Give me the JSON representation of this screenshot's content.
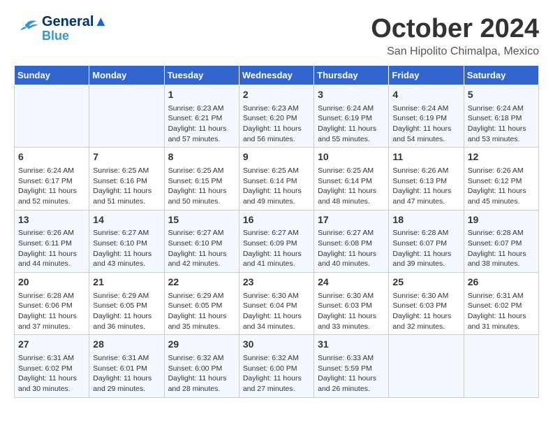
{
  "header": {
    "logo": {
      "line1": "General",
      "line2": "Blue"
    },
    "title": "October 2024",
    "subtitle": "San Hipolito Chimalpa, Mexico"
  },
  "days_of_week": [
    "Sunday",
    "Monday",
    "Tuesday",
    "Wednesday",
    "Thursday",
    "Friday",
    "Saturday"
  ],
  "weeks": [
    [
      {
        "day": null
      },
      {
        "day": null
      },
      {
        "day": "1",
        "sunrise": "6:23 AM",
        "sunset": "6:21 PM",
        "daylight": "11 hours and 57 minutes."
      },
      {
        "day": "2",
        "sunrise": "6:23 AM",
        "sunset": "6:20 PM",
        "daylight": "11 hours and 56 minutes."
      },
      {
        "day": "3",
        "sunrise": "6:24 AM",
        "sunset": "6:19 PM",
        "daylight": "11 hours and 55 minutes."
      },
      {
        "day": "4",
        "sunrise": "6:24 AM",
        "sunset": "6:19 PM",
        "daylight": "11 hours and 54 minutes."
      },
      {
        "day": "5",
        "sunrise": "6:24 AM",
        "sunset": "6:18 PM",
        "daylight": "11 hours and 53 minutes."
      }
    ],
    [
      {
        "day": "6",
        "sunrise": "6:24 AM",
        "sunset": "6:17 PM",
        "daylight": "11 hours and 52 minutes."
      },
      {
        "day": "7",
        "sunrise": "6:25 AM",
        "sunset": "6:16 PM",
        "daylight": "11 hours and 51 minutes."
      },
      {
        "day": "8",
        "sunrise": "6:25 AM",
        "sunset": "6:15 PM",
        "daylight": "11 hours and 50 minutes."
      },
      {
        "day": "9",
        "sunrise": "6:25 AM",
        "sunset": "6:14 PM",
        "daylight": "11 hours and 49 minutes."
      },
      {
        "day": "10",
        "sunrise": "6:25 AM",
        "sunset": "6:14 PM",
        "daylight": "11 hours and 48 minutes."
      },
      {
        "day": "11",
        "sunrise": "6:26 AM",
        "sunset": "6:13 PM",
        "daylight": "11 hours and 47 minutes."
      },
      {
        "day": "12",
        "sunrise": "6:26 AM",
        "sunset": "6:12 PM",
        "daylight": "11 hours and 45 minutes."
      }
    ],
    [
      {
        "day": "13",
        "sunrise": "6:26 AM",
        "sunset": "6:11 PM",
        "daylight": "11 hours and 44 minutes."
      },
      {
        "day": "14",
        "sunrise": "6:27 AM",
        "sunset": "6:10 PM",
        "daylight": "11 hours and 43 minutes."
      },
      {
        "day": "15",
        "sunrise": "6:27 AM",
        "sunset": "6:10 PM",
        "daylight": "11 hours and 42 minutes."
      },
      {
        "day": "16",
        "sunrise": "6:27 AM",
        "sunset": "6:09 PM",
        "daylight": "11 hours and 41 minutes."
      },
      {
        "day": "17",
        "sunrise": "6:27 AM",
        "sunset": "6:08 PM",
        "daylight": "11 hours and 40 minutes."
      },
      {
        "day": "18",
        "sunrise": "6:28 AM",
        "sunset": "6:07 PM",
        "daylight": "11 hours and 39 minutes."
      },
      {
        "day": "19",
        "sunrise": "6:28 AM",
        "sunset": "6:07 PM",
        "daylight": "11 hours and 38 minutes."
      }
    ],
    [
      {
        "day": "20",
        "sunrise": "6:28 AM",
        "sunset": "6:06 PM",
        "daylight": "11 hours and 37 minutes."
      },
      {
        "day": "21",
        "sunrise": "6:29 AM",
        "sunset": "6:05 PM",
        "daylight": "11 hours and 36 minutes."
      },
      {
        "day": "22",
        "sunrise": "6:29 AM",
        "sunset": "6:05 PM",
        "daylight": "11 hours and 35 minutes."
      },
      {
        "day": "23",
        "sunrise": "6:30 AM",
        "sunset": "6:04 PM",
        "daylight": "11 hours and 34 minutes."
      },
      {
        "day": "24",
        "sunrise": "6:30 AM",
        "sunset": "6:03 PM",
        "daylight": "11 hours and 33 minutes."
      },
      {
        "day": "25",
        "sunrise": "6:30 AM",
        "sunset": "6:03 PM",
        "daylight": "11 hours and 32 minutes."
      },
      {
        "day": "26",
        "sunrise": "6:31 AM",
        "sunset": "6:02 PM",
        "daylight": "11 hours and 31 minutes."
      }
    ],
    [
      {
        "day": "27",
        "sunrise": "6:31 AM",
        "sunset": "6:02 PM",
        "daylight": "11 hours and 30 minutes."
      },
      {
        "day": "28",
        "sunrise": "6:31 AM",
        "sunset": "6:01 PM",
        "daylight": "11 hours and 29 minutes."
      },
      {
        "day": "29",
        "sunrise": "6:32 AM",
        "sunset": "6:00 PM",
        "daylight": "11 hours and 28 minutes."
      },
      {
        "day": "30",
        "sunrise": "6:32 AM",
        "sunset": "6:00 PM",
        "daylight": "11 hours and 27 minutes."
      },
      {
        "day": "31",
        "sunrise": "6:33 AM",
        "sunset": "5:59 PM",
        "daylight": "11 hours and 26 minutes."
      },
      {
        "day": null
      },
      {
        "day": null
      }
    ]
  ],
  "labels": {
    "sunrise": "Sunrise: ",
    "sunset": "Sunset: ",
    "daylight": "Daylight: "
  }
}
